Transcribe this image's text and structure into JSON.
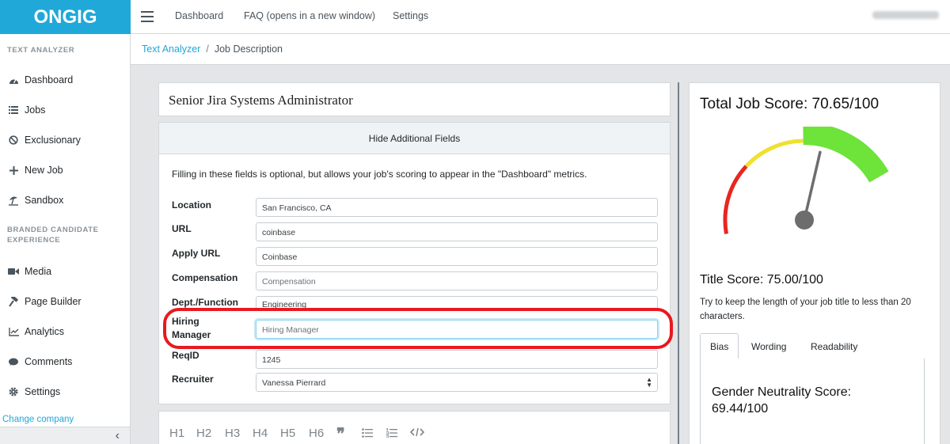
{
  "brand": "ONGIG",
  "header": {
    "nav": [
      "Dashboard",
      "FAQ (opens in a new window)",
      "Settings"
    ]
  },
  "sidebar": {
    "section1": "TEXT ANALYZER",
    "items1": [
      {
        "label": "Dashboard",
        "icon": "dashboard-icon"
      },
      {
        "label": "Jobs",
        "icon": "list-icon"
      },
      {
        "label": "Exclusionary",
        "icon": "ban-icon"
      },
      {
        "label": "New Job",
        "icon": "plus-icon"
      },
      {
        "label": "Sandbox",
        "icon": "umbrella-beach-icon"
      }
    ],
    "section2_line1": "BRANDED CANDIDATE",
    "section2_line2": "EXPERIENCE",
    "items2": [
      {
        "label": "Media",
        "icon": "video-icon"
      },
      {
        "label": "Page Builder",
        "icon": "hammer-icon"
      },
      {
        "label": "Analytics",
        "icon": "chart-icon"
      },
      {
        "label": "Comments",
        "icon": "comment-icon"
      },
      {
        "label": "Settings",
        "icon": "gear-icon"
      }
    ],
    "change_company": "Change company"
  },
  "breadcrumb": {
    "root": "Text Analyzer",
    "current": "Job Description"
  },
  "job": {
    "title": "Senior Jira Systems Administrator",
    "toggle_fields": "Hide Additional Fields",
    "optional_note": "Filling in these fields is optional, but allows your job's scoring to appear in the \"Dashboard\" metrics.",
    "fields": {
      "location": {
        "label": "Location",
        "value": "San Francisco, CA"
      },
      "url": {
        "label": "URL",
        "value": "coinbase"
      },
      "apply_url": {
        "label": "Apply URL",
        "value": "Coinbase"
      },
      "compensation": {
        "label": "Compensation",
        "placeholder": "Compensation"
      },
      "dept": {
        "label": "Dept./Function",
        "value": "Engineering"
      },
      "hiring_manager": {
        "label_line1": "Hiring",
        "label_line2": "Manager",
        "placeholder": "Hiring Manager"
      },
      "reqid": {
        "label": "ReqID",
        "value": "1245"
      },
      "recruiter": {
        "label": "Recruiter",
        "value": "Vanessa Pierrard"
      }
    }
  },
  "editor_toolbar": [
    "H1",
    "H2",
    "H3",
    "H4",
    "H5",
    "H6"
  ],
  "score": {
    "total": "Total Job Score: 70.65/100",
    "total_value": 70.65,
    "title_score": "Title Score: 75.00/100",
    "title_hint": "Try to keep the length of your job title to less than 20 characters.",
    "tabs": [
      "Bias",
      "Wording",
      "Readability"
    ],
    "active_tab": "Bias",
    "gender_line1": "Gender Neutrality Score:",
    "gender_line2": "69.44/100"
  },
  "colors": {
    "primary": "#20a8d8",
    "highlight": "#e8191f",
    "gauge_red": "#e8261f",
    "gauge_yellow": "#f0e030",
    "gauge_green": "#6ee33a"
  }
}
